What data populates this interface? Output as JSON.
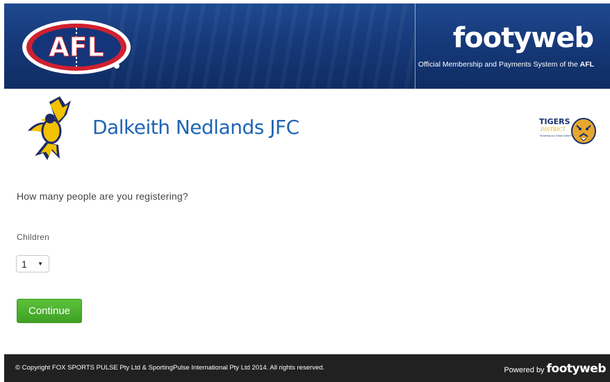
{
  "header": {
    "afl_logo_text": "AFL",
    "brand_name": "footyweb",
    "tagline_prefix": "Official Membership and Payments System of the ",
    "tagline_suffix": "AFL"
  },
  "club": {
    "name": "Dalkeith Nedlands JFC",
    "partner_logo_text": "TIGERS",
    "partner_logo_subtext": "DISTRICT",
    "partner_logo_slogan": "\"Growing our Great Game\""
  },
  "form": {
    "question": "How many people are you registering?",
    "children_label": "Children",
    "children_selected": "1",
    "continue_label": "Continue"
  },
  "footer": {
    "copyright": "© Copyright FOX SPORTS PULSE Pty Ltd & SportingPulse International Pty Ltd  2014.  All rights reserved.",
    "powered_by": "Powered by",
    "powered_brand": "footyweb"
  },
  "colors": {
    "header_blue": "#16397a",
    "club_name_blue": "#1f64b5",
    "button_green": "#4bb12e",
    "footer_bg": "#212121"
  }
}
